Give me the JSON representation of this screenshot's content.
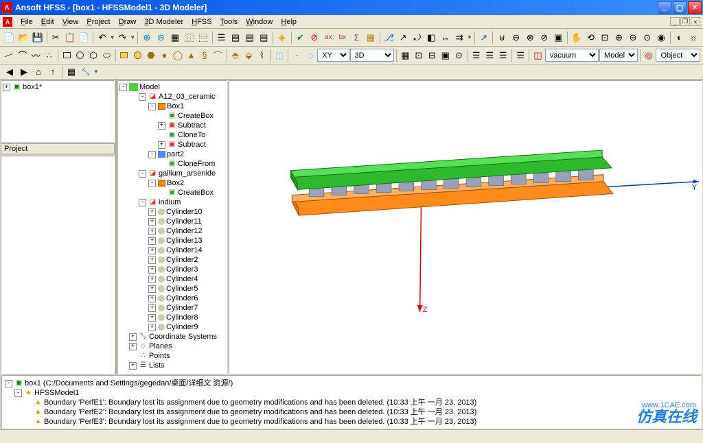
{
  "titlebar": {
    "title": "Ansoft HFSS - [box1 - HFSSModel1 - 3D Modeler]"
  },
  "menu": [
    "File",
    "Edit",
    "View",
    "Project",
    "Draw",
    "3D Modeler",
    "HFSS",
    "Tools",
    "Window",
    "Help"
  ],
  "toolbar2": {
    "plane": "XY",
    "view": "3D",
    "material": "vacuum",
    "selmode": "Model",
    "seltarget": "Object"
  },
  "project_tree": {
    "root": "box1*"
  },
  "panes": {
    "project_label": "Project"
  },
  "model_tree": {
    "root": "Model",
    "nodes": [
      {
        "label": "A12_03_ceramic",
        "icon": "ic-mat",
        "toggle": "-",
        "depth": 1,
        "children": [
          {
            "label": "Box1",
            "icon": "ic-box",
            "toggle": "-",
            "depth": 2,
            "children": [
              {
                "label": "CreateBox",
                "icon": "ic-cmd",
                "depth": 3
              },
              {
                "label": "Subtract",
                "icon": "ic-sub",
                "toggle": "+",
                "depth": 3
              },
              {
                "label": "CloneTo",
                "icon": "ic-cmd",
                "depth": 3
              },
              {
                "label": "Subtract",
                "icon": "ic-sub",
                "toggle": "+",
                "depth": 3
              }
            ]
          },
          {
            "label": "part2",
            "icon": "ic-part",
            "toggle": "-",
            "depth": 2,
            "children": [
              {
                "label": "CloneFrom",
                "icon": "ic-cmd",
                "depth": 3
              }
            ]
          }
        ]
      },
      {
        "label": "gallium_arsenide",
        "icon": "ic-mat",
        "toggle": "-",
        "depth": 1,
        "children": [
          {
            "label": "Box2",
            "icon": "ic-box",
            "toggle": "-",
            "depth": 2,
            "children": [
              {
                "label": "CreateBox",
                "icon": "ic-cmd",
                "depth": 3
              }
            ]
          }
        ]
      },
      {
        "label": "indium",
        "icon": "ic-mat",
        "toggle": "-",
        "depth": 1,
        "children": [
          {
            "label": "Cylinder10",
            "icon": "ic-cyl",
            "toggle": "+",
            "depth": 2
          },
          {
            "label": "Cylinder11",
            "icon": "ic-cyl",
            "toggle": "+",
            "depth": 2
          },
          {
            "label": "Cylinder12",
            "icon": "ic-cyl",
            "toggle": "+",
            "depth": 2
          },
          {
            "label": "Cylinder13",
            "icon": "ic-cyl",
            "toggle": "+",
            "depth": 2
          },
          {
            "label": "Cylinder14",
            "icon": "ic-cyl",
            "toggle": "+",
            "depth": 2
          },
          {
            "label": "Cylinder2",
            "icon": "ic-cyl",
            "toggle": "+",
            "depth": 2
          },
          {
            "label": "Cylinder3",
            "icon": "ic-cyl",
            "toggle": "+",
            "depth": 2
          },
          {
            "label": "Cylinder4",
            "icon": "ic-cyl",
            "toggle": "+",
            "depth": 2
          },
          {
            "label": "Cylinder5",
            "icon": "ic-cyl",
            "toggle": "+",
            "depth": 2
          },
          {
            "label": "Cylinder6",
            "icon": "ic-cyl",
            "toggle": "+",
            "depth": 2
          },
          {
            "label": "Cylinder7",
            "icon": "ic-cyl",
            "toggle": "+",
            "depth": 2
          },
          {
            "label": "Cylinder8",
            "icon": "ic-cyl",
            "toggle": "+",
            "depth": 2
          },
          {
            "label": "Cylinder9",
            "icon": "ic-cyl",
            "toggle": "+",
            "depth": 2
          }
        ]
      },
      {
        "label": "Coordinate Systems",
        "icon": "ic-cs",
        "toggle": "+",
        "depth": 0
      },
      {
        "label": "Planes",
        "icon": "ic-plane",
        "toggle": "+",
        "depth": 0
      },
      {
        "label": "Points",
        "icon": "ic-pts",
        "depth": 0
      },
      {
        "label": "Lists",
        "icon": "ic-list",
        "toggle": "+",
        "depth": 0
      }
    ]
  },
  "messages": {
    "root": "box1 (C:/Documents and Settings/gegedan/桌面/详细文 资源/)",
    "design": "HFSSModel1",
    "items": [
      "Boundary 'PerfE1': Boundary lost its assignment due to geometry modifications and has been deleted. (10:33 上午  一月 23, 2013)",
      "Boundary 'PerfE2': Boundary lost its assignment due to geometry modifications and has been deleted. (10:33 上午  一月 23, 2013)",
      "Boundary 'PerfE3': Boundary lost its assignment due to geometry modifications and has been deleted. (10:33 上午  一月 23, 2013)"
    ]
  },
  "axes": {
    "y": "Y",
    "z": "Z"
  },
  "watermark": "仿真在线",
  "url": "www.1CAE.com"
}
